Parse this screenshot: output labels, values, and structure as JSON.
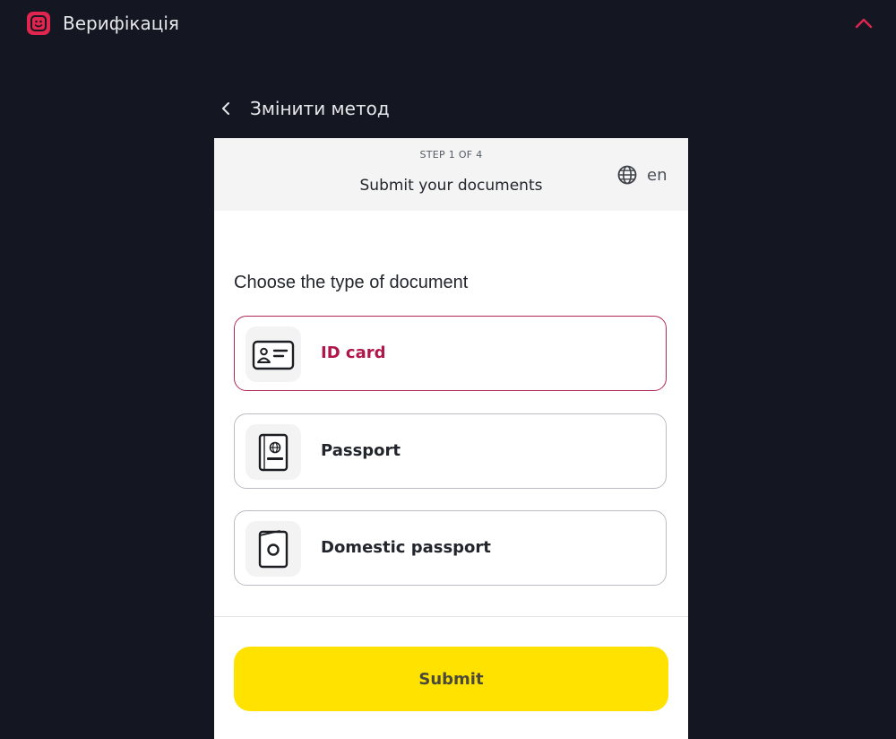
{
  "app": {
    "title": "Верифікація",
    "logo_icon": "face-scan-icon",
    "collapse_icon": "chevron-up-icon",
    "accent_color": "#e0264f"
  },
  "back": {
    "label": "Змінити метод",
    "icon": "chevron-left-icon"
  },
  "card": {
    "step": "STEP 1 OF 4",
    "title": "Submit your documents",
    "language": {
      "label": "en",
      "icon": "globe-icon"
    },
    "section_title": "Choose the type of document",
    "options": [
      {
        "label": "ID card",
        "icon": "id-card-icon",
        "selected": true
      },
      {
        "label": "Passport",
        "icon": "passport-icon",
        "selected": false
      },
      {
        "label": "Domestic passport",
        "icon": "domestic-passport-icon",
        "selected": false
      }
    ],
    "submit_label": "Submit",
    "submit_color": "#ffe200",
    "selected_color": "#b0164a"
  }
}
